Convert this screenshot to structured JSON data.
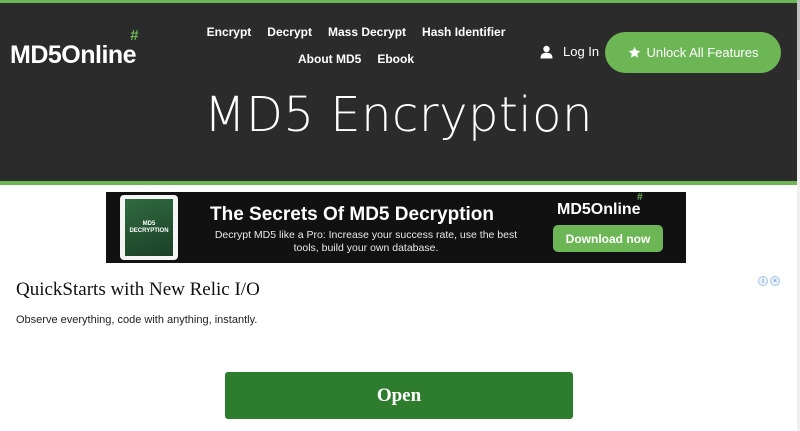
{
  "header": {
    "logo_text": "MD5Online",
    "logo_hash": "#",
    "nav": [
      "Encrypt",
      "Decrypt",
      "Mass Decrypt",
      "Hash Identifier",
      "About MD5",
      "Ebook"
    ],
    "login_label": "Log In",
    "unlock_label": "Unlock All Features",
    "page_title": "MD5 Encryption"
  },
  "banner": {
    "book_label": "MD5 DECRYPTION",
    "title": "The Secrets Of MD5 Decryption",
    "subtitle": "Decrypt MD5 like a Pro: Increase your success rate, use the best tools, build your own database.",
    "logo_text": "MD5Online",
    "logo_hash": "#",
    "button_label": "Download now"
  },
  "ad": {
    "title": "QuickStarts with New Relic I/O",
    "description": "Observe everything, code with anything, instantly.",
    "button_label": "Open",
    "badge_icons": [
      "info-icon",
      "close-icon"
    ]
  },
  "colors": {
    "header_bg": "#2b2b2b",
    "accent_green": "#6cb655",
    "open_button_green": "#2e7d2e"
  }
}
